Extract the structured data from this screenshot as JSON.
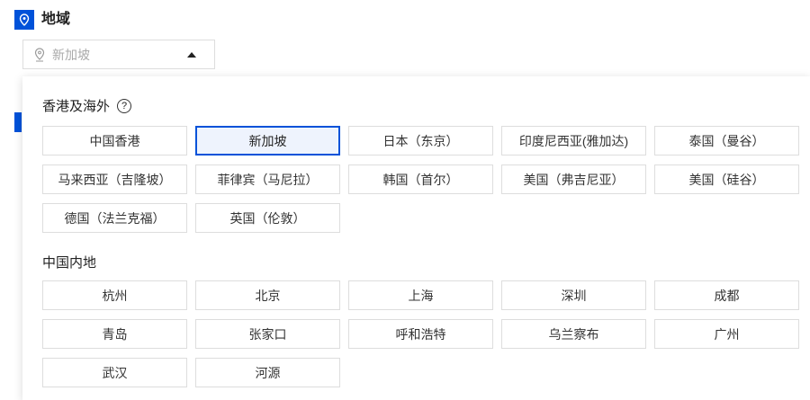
{
  "header": {
    "title": "地域"
  },
  "select": {
    "value": "新加坡"
  },
  "sections": [
    {
      "title": "香港及海外",
      "items": [
        "中国香港",
        "新加坡",
        "日本（东京）",
        "印度尼西亚(雅加达)",
        "泰国（曼谷）",
        "马来西亚（吉隆坡）",
        "菲律宾（马尼拉）",
        "韩国（首尔）",
        "美国（弗吉尼亚）",
        "美国（硅谷）",
        "德国（法兰克福）",
        "英国（伦敦）"
      ]
    },
    {
      "title": "中国内地",
      "items": [
        "杭州",
        "北京",
        "上海",
        "深圳",
        "成都",
        "青岛",
        "张家口",
        "呼和浩特",
        "乌兰察布",
        "广州",
        "武汉",
        "河源"
      ]
    }
  ],
  "selected": "新加坡",
  "accent": "#0052d9"
}
